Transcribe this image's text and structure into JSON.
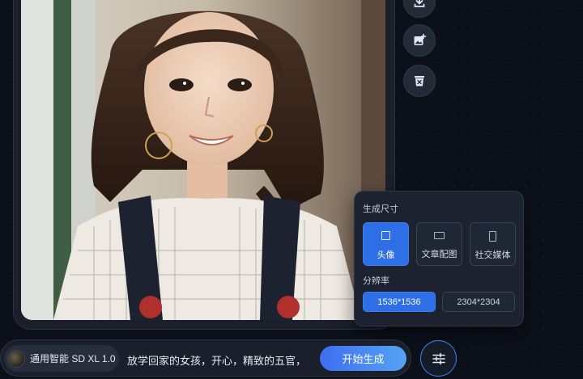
{
  "preview": {
    "image_alt": "Portrait of a smiling girl with bangs and pigtails wearing a striped blouse"
  },
  "side_actions": [
    {
      "name": "download-button",
      "icon": "download-icon"
    },
    {
      "name": "add-image-button",
      "icon": "image-plus-icon"
    },
    {
      "name": "delete-button",
      "icon": "trash-icon"
    }
  ],
  "settings_panel": {
    "size_label": "生成尺寸",
    "sizes": [
      {
        "label": "头像",
        "selected": true
      },
      {
        "label": "文章配图",
        "selected": false
      },
      {
        "label": "社交媒体",
        "selected": false
      }
    ],
    "resolution_label": "分辨率",
    "resolutions": [
      {
        "label": "1536*1536",
        "selected": true
      },
      {
        "label": "2304*2304",
        "selected": false
      }
    ]
  },
  "prompt_bar": {
    "model_name": "通用智能 SD XL 1.0",
    "prompt": "放学回家的女孩，开心，精致的五官，",
    "generate_label": "开始生成"
  },
  "icons": {
    "settings_toggle": "sliders-icon"
  },
  "colors": {
    "accent": "#2e6ee6",
    "background": "#0c1019",
    "panel": "#1c2230"
  }
}
